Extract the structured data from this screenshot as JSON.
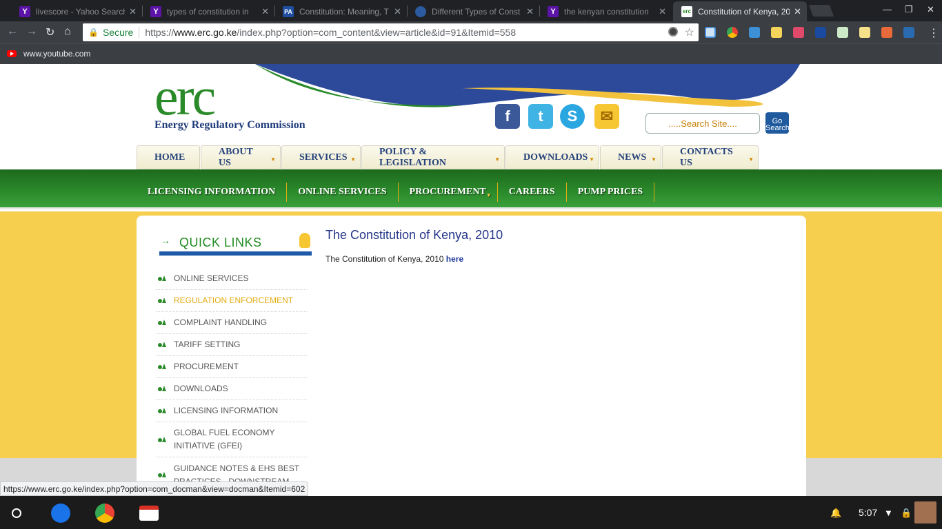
{
  "browser": {
    "tabs": [
      {
        "title": "livescore - Yahoo Search",
        "icon": "Y",
        "color": "#5b13a8"
      },
      {
        "title": "types of constitution in",
        "icon": "Y",
        "color": "#5b13a8"
      },
      {
        "title": "Constitution: Meaning, T",
        "icon": "PA",
        "color": "#1f4ea0"
      },
      {
        "title": "Different Types of Const",
        "icon": "",
        "color": "#2b5aa0"
      },
      {
        "title": "the kenyan constitution",
        "icon": "Y",
        "color": "#5b13a8"
      },
      {
        "title": "Constitution of Kenya, 20",
        "icon": "erc",
        "color": "#2a8a2a"
      }
    ],
    "security_label": "Secure",
    "url_scheme": "https://",
    "url_host": "www.erc.go.ke",
    "url_path": "/index.php?option=com_content&view=article&id=91&Itemid=558",
    "bookmark": "www.youtube.com",
    "status_url": "https://www.erc.go.ke/index.php?option=com_docman&view=docman&Itemid=602"
  },
  "site": {
    "logo_text": "erc",
    "org_name": "Energy Regulatory Commission",
    "search_placeholder": ".....Search Site....",
    "go_label": "Go Search",
    "main_nav": [
      "HOME",
      "ABOUT US",
      "SERVICES",
      "POLICY & LEGISLATION",
      "DOWNLOADS",
      "NEWS",
      "CONTACTS US"
    ],
    "sub_nav": [
      "LICENSING INFORMATION",
      "ONLINE SERVICES",
      "PROCUREMENT",
      "CAREERS",
      "PUMP PRICES"
    ],
    "quick_links_title": "QUICK LINKS",
    "quick_links": [
      "ONLINE SERVICES",
      "REGULATION ENFORCEMENT",
      "COMPLAINT HANDLING",
      "TARIFF SETTING",
      "PROCUREMENT",
      "DOWNLOADS",
      "LICENSING INFORMATION",
      "GLOBAL FUEL ECONOMY INITIATIVE (GFEI)",
      "GUIDANCE NOTES & EHS BEST PRACTICES - DOWNSTREAM"
    ],
    "article_title": "The Constitution of Kenya, 2010",
    "article_text": "The Constitution of Kenya, 2010 ",
    "article_link": "here"
  },
  "shelf": {
    "time": "5:07"
  }
}
